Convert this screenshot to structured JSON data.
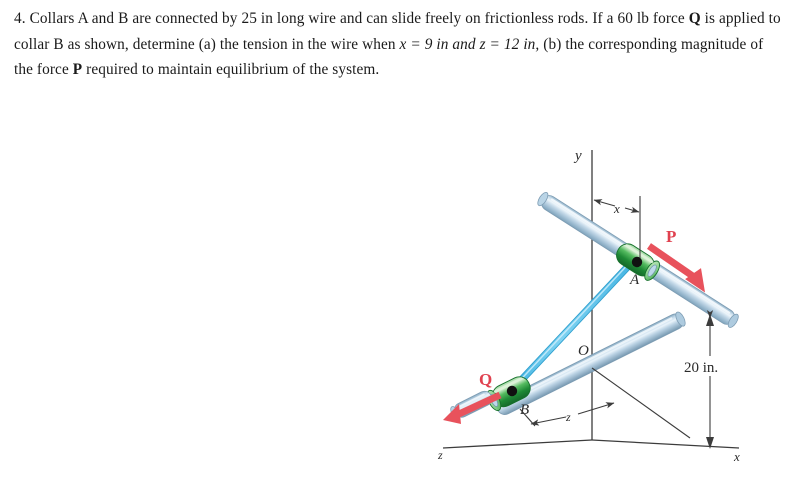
{
  "problem": {
    "number": "4.",
    "segments": [
      {
        "text": "4. Collars A and B are connected by 25 in long wire and can slide freely on frictionless rods. If a 60 lb force ",
        "style": "normal"
      },
      {
        "text": "Q",
        "style": "bold"
      },
      {
        "text": " is applied to collar B as shown, determine (a) the tension in the wire when ",
        "style": "normal"
      },
      {
        "text": "x = 9 in and z = 12 in,",
        "style": "italic"
      },
      {
        "text": " (b) the corresponding magnitude of the force ",
        "style": "normal"
      },
      {
        "text": "P",
        "style": "bold"
      },
      {
        "text": " required to maintain equilibrium of the system.",
        "style": "normal"
      }
    ],
    "full_text": "4. Collars A and B are connected by 25 in long wire and can slide freely on frictionless rods. If a 60 lb force Q is applied to collar B as shown, determine (a) the tension in the wire when x = 9 in and z = 12 in, (b) the corresponding magnitude of the force P required to maintain equilibrium of the system."
  },
  "figure": {
    "axis_labels": {
      "y": "y",
      "x": "x",
      "z": "z"
    },
    "origin_label": "O",
    "collar_a_label": "A",
    "collar_b_label": "B",
    "force_p_label": "P",
    "force_q_label": "Q",
    "dim_x_label": "x",
    "dim_z_label": "z",
    "dim_height_label": "20 in.",
    "colors": {
      "rod_fill": "#b7cfe0",
      "rod_highlight": "#e4eef6",
      "rod_edge": "#7d9cb3",
      "collar_green": "#3aa84a",
      "collar_green_light": "#bde3bc",
      "collar_green_dark": "#1c7a32",
      "wire_blue": "#5fc4ea",
      "wire_blue_dark": "#2f9fce",
      "force_red": "#e8525c",
      "force_red_dark": "#d6313f",
      "axis_line": "#3c3c3c",
      "label_text": "#2a2a2a",
      "node_dot": "#111111"
    }
  }
}
